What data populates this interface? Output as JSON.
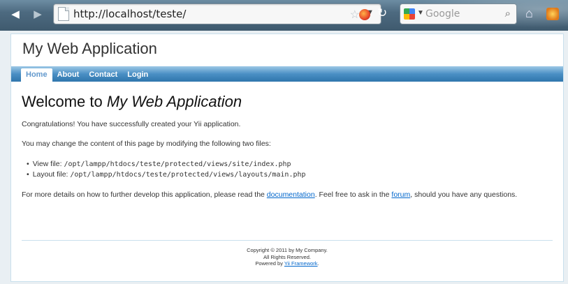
{
  "browser": {
    "url": "http://localhost/teste/",
    "search_placeholder": "Google",
    "icons": {
      "back": "back-arrow-icon",
      "forward": "forward-arrow-icon",
      "page": "page-icon",
      "bookmark": "star-icon",
      "reload": "reload-icon",
      "search": "magnifier-icon",
      "home": "home-icon"
    }
  },
  "app": {
    "title": "My Web Application",
    "menu": [
      {
        "label": "Home",
        "active": true
      },
      {
        "label": "About"
      },
      {
        "label": "Contact"
      },
      {
        "label": "Login"
      }
    ]
  },
  "content": {
    "heading_prefix": "Welcome to ",
    "heading_app": "My Web Application",
    "congrats": "Congratulations! You have successfully created your Yii application.",
    "change_intro": "You may change the content of this page by modifying the following two files:",
    "files": [
      {
        "label": "View file: ",
        "path": "/opt/lampp/htdocs/teste/protected/views/site/index.php"
      },
      {
        "label": "Layout file: ",
        "path": "/opt/lampp/htdocs/teste/protected/views/layouts/main.php"
      }
    ],
    "details_1": "For more details on how to further develop this application, please read the ",
    "documentation_link": "documentation",
    "details_2": ". Feel free to ask in the ",
    "forum_link": "forum",
    "details_3": ", should you have any questions."
  },
  "footer": {
    "copyright": "Copyright © 2011 by My Company.",
    "rights": "All Rights Reserved.",
    "powered_prefix": "Powered by ",
    "powered_link": "Yii Framework",
    "powered_suffix": "."
  },
  "colors": {
    "menu_gradient_top": "#9cc8e6",
    "menu_gradient_bottom": "#2f76ad",
    "link": "#0066cc",
    "active_menu_text": "#6399cd"
  }
}
